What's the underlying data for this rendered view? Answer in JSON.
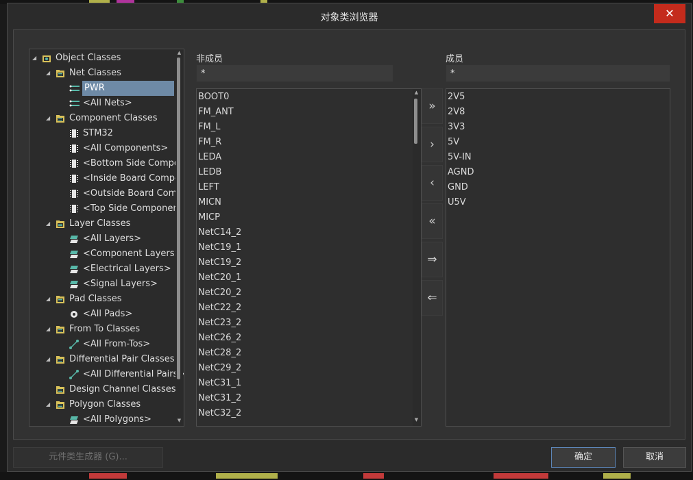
{
  "dialog": {
    "title": "对象类浏览器",
    "close_label": "✕"
  },
  "tree": {
    "items": [
      {
        "level": 0,
        "toggle": "◢",
        "icon": "folder-class-icon",
        "label": "Object Classes",
        "selected": false
      },
      {
        "level": 1,
        "toggle": "◢",
        "icon": "net-folder-icon",
        "label": "Net Classes",
        "selected": false
      },
      {
        "level": 2,
        "toggle": "",
        "icon": "net-icon",
        "label": "PWR",
        "selected": true
      },
      {
        "level": 2,
        "toggle": "",
        "icon": "net-icon",
        "label": "<All Nets>",
        "selected": false
      },
      {
        "level": 1,
        "toggle": "◢",
        "icon": "component-folder-icon",
        "label": "Component Classes",
        "selected": false
      },
      {
        "level": 2,
        "toggle": "",
        "icon": "component-icon",
        "label": "STM32",
        "selected": false
      },
      {
        "level": 2,
        "toggle": "",
        "icon": "component-icon",
        "label": "<All Components>",
        "selected": false
      },
      {
        "level": 2,
        "toggle": "",
        "icon": "component-icon",
        "label": "<Bottom Side Compo",
        "selected": false
      },
      {
        "level": 2,
        "toggle": "",
        "icon": "component-icon",
        "label": "<Inside Board Compo",
        "selected": false
      },
      {
        "level": 2,
        "toggle": "",
        "icon": "component-icon",
        "label": "<Outside Board Com",
        "selected": false
      },
      {
        "level": 2,
        "toggle": "",
        "icon": "component-icon",
        "label": "<Top Side Componen",
        "selected": false
      },
      {
        "level": 1,
        "toggle": "◢",
        "icon": "layer-folder-icon",
        "label": "Layer Classes",
        "selected": false
      },
      {
        "level": 2,
        "toggle": "",
        "icon": "layer-icon",
        "label": "<All Layers>",
        "selected": false
      },
      {
        "level": 2,
        "toggle": "",
        "icon": "layer-icon",
        "label": "<Component Layers>",
        "selected": false
      },
      {
        "level": 2,
        "toggle": "",
        "icon": "layer-icon",
        "label": "<Electrical Layers>",
        "selected": false
      },
      {
        "level": 2,
        "toggle": "",
        "icon": "layer-icon",
        "label": "<Signal Layers>",
        "selected": false
      },
      {
        "level": 1,
        "toggle": "◢",
        "icon": "pad-folder-icon",
        "label": "Pad Classes",
        "selected": false
      },
      {
        "level": 2,
        "toggle": "",
        "icon": "pad-icon",
        "label": "<All Pads>",
        "selected": false
      },
      {
        "level": 1,
        "toggle": "◢",
        "icon": "fromto-folder-icon",
        "label": "From To Classes",
        "selected": false
      },
      {
        "level": 2,
        "toggle": "",
        "icon": "fromto-icon",
        "label": "<All From-Tos>",
        "selected": false
      },
      {
        "level": 1,
        "toggle": "◢",
        "icon": "diffpair-folder-icon",
        "label": "Differential Pair Classes",
        "selected": false
      },
      {
        "level": 2,
        "toggle": "",
        "icon": "fromto-icon",
        "label": "<All Differential Pairs>",
        "selected": false
      },
      {
        "level": 1,
        "toggle": "",
        "icon": "channel-folder-icon",
        "label": "Design Channel Classes",
        "selected": false
      },
      {
        "level": 1,
        "toggle": "◢",
        "icon": "polygon-folder-icon",
        "label": "Polygon Classes",
        "selected": false
      },
      {
        "level": 2,
        "toggle": "",
        "icon": "layer-icon",
        "label": "<All Polygons>",
        "selected": false
      }
    ]
  },
  "non_members": {
    "caption": "非成员",
    "filter_value": "*",
    "items": [
      "BOOT0",
      "FM_ANT",
      "FM_L",
      "FM_R",
      "LEDA",
      "LEDB",
      "LEFT",
      "MICN",
      "MICP",
      "NetC14_2",
      "NetC19_1",
      "NetC19_2",
      "NetC20_1",
      "NetC20_2",
      "NetC22_2",
      "NetC23_2",
      "NetC26_2",
      "NetC28_2",
      "NetC29_2",
      "NetC31_1",
      "NetC31_2",
      "NetC32_2"
    ]
  },
  "members": {
    "caption": "成员",
    "filter_value": "*",
    "items": [
      "2V5",
      "2V8",
      "3V3",
      "5V",
      "5V-IN",
      "AGND",
      "GND",
      "U5V"
    ]
  },
  "move_buttons": [
    {
      "name": "move-all-right-button",
      "glyph": "»"
    },
    {
      "name": "move-right-button",
      "glyph": "›"
    },
    {
      "name": "move-left-button",
      "glyph": "‹"
    },
    {
      "name": "move-all-left-button",
      "glyph": "«"
    },
    {
      "name": "move-filtered-right-button",
      "glyph": "⇒"
    },
    {
      "name": "move-filtered-left-button",
      "glyph": "⇐"
    }
  ],
  "footer": {
    "generator_label": "元件类生成器 (G)...",
    "ok_label": "确定",
    "cancel_label": "取消"
  },
  "colors": {
    "accent": "#6e8aa6",
    "close": "#c42b1c",
    "ok_border": "#5d86b8"
  }
}
